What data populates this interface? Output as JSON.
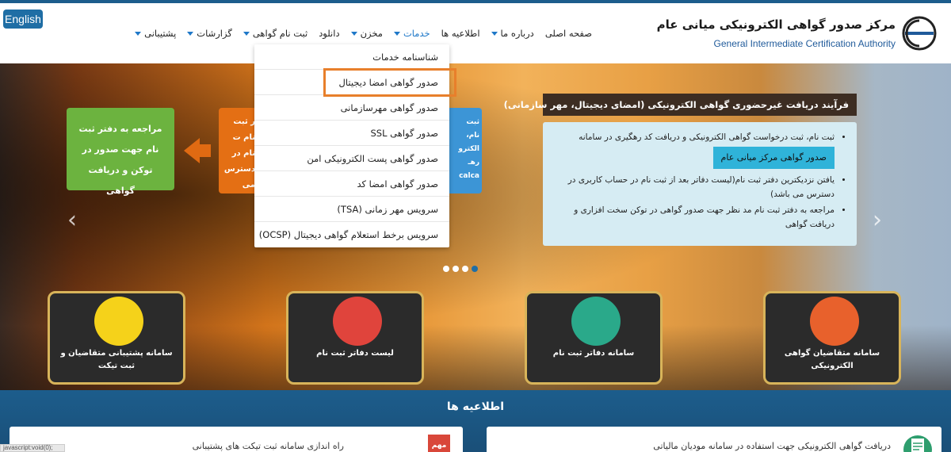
{
  "header": {
    "lang_button": "English",
    "logo_title": "مرکز صدور گواهی الکترونیکی میانی عام",
    "logo_subtitle": "General Intermediate Certification Authority"
  },
  "nav": {
    "items": [
      {
        "label": "صفحه اصلی",
        "caret": false,
        "active": false
      },
      {
        "label": "درباره ما",
        "caret": true,
        "active": false
      },
      {
        "label": "اطلاعیه ها",
        "caret": false,
        "active": false
      },
      {
        "label": "خدمات",
        "caret": true,
        "active": true
      },
      {
        "label": "مخزن",
        "caret": true,
        "active": false
      },
      {
        "label": "دانلود",
        "caret": false,
        "active": false
      },
      {
        "label": "ثبت نام گواهی",
        "caret": true,
        "active": false
      },
      {
        "label": "گزارشات",
        "caret": true,
        "active": false
      },
      {
        "label": "پشتیبانی",
        "caret": true,
        "active": false
      }
    ]
  },
  "dropdown": {
    "items": [
      "شناسنامه خدمات",
      "صدور گواهی امضا دیجیتال",
      "صدور گواهی مهرسازمانی",
      "صدور گواهی SSL",
      "صدور گواهی پست الکترونیکی امن",
      "صدور گواهی امضا کد",
      "سرویس مهر زمانی (TSA)",
      "سرویس برخط استعلام گواهی دیجیتال (OCSP)"
    ],
    "highlighted_index": 1
  },
  "slider": {
    "green_box": "مراجعه به دفتر ثبت نام جهت صدور در توکن و دریافت گواهی",
    "orange_box": "ر ثبت نام ت نام در دسترس می",
    "blue_box": "ثبت نام، الکترو رهـ calca",
    "process_title": "فرآیند دریافت غیرحضوری گواهی الکترونیکی (امضای دیجیتال، مهر سازمانی)",
    "steps": [
      "ثبت نام، ثبت درخواست گواهی الکترونیکی و دریافت کد رهگیری در سامانه",
      "یافتن نزدیکترین دفتر ثبت نام(لیست دفاتر بعد از ثبت نام در حساب کاربری در دسترس می باشد)",
      "مراجعه به دفتر ثبت نام مد نظر جهت صدور گواهی در توکن سخت افزاری و دریافت گواهی"
    ],
    "cta_button": "صدور گواهی مرکز میانی عام",
    "prev_arrow": "‹",
    "next_arrow": "›",
    "dots_count": 4,
    "active_dot": 4
  },
  "services": [
    {
      "label": "سامانه پشتیبانی متقاضیان و ثبت تیکت",
      "icon": "headset-laptop-icon",
      "color": "#f5d21a"
    },
    {
      "label": "لیست دفاتر ثبت نام",
      "icon": "key-icon",
      "color": "#e0443c"
    },
    {
      "label": "سامانه دفاتر ثبت نام",
      "icon": "door-enter-icon",
      "color": "#2aa98a"
    },
    {
      "label": "سامانه متقاضیان گواهی الکترونیکی",
      "icon": "tablet-hand-icon",
      "color": "#e8612c"
    }
  ],
  "news": {
    "title": "اطلاعیه ها",
    "items": [
      {
        "text": "راه اندازی سامانه ثبت تیکت های پشتیبانی",
        "badge": "مهم"
      },
      {
        "text": "دریافت گواهی الکترونیکی جهت استفاده در سامانه مودیان مالیاتی"
      }
    ]
  },
  "status_bar": "javascript:void(0);"
}
